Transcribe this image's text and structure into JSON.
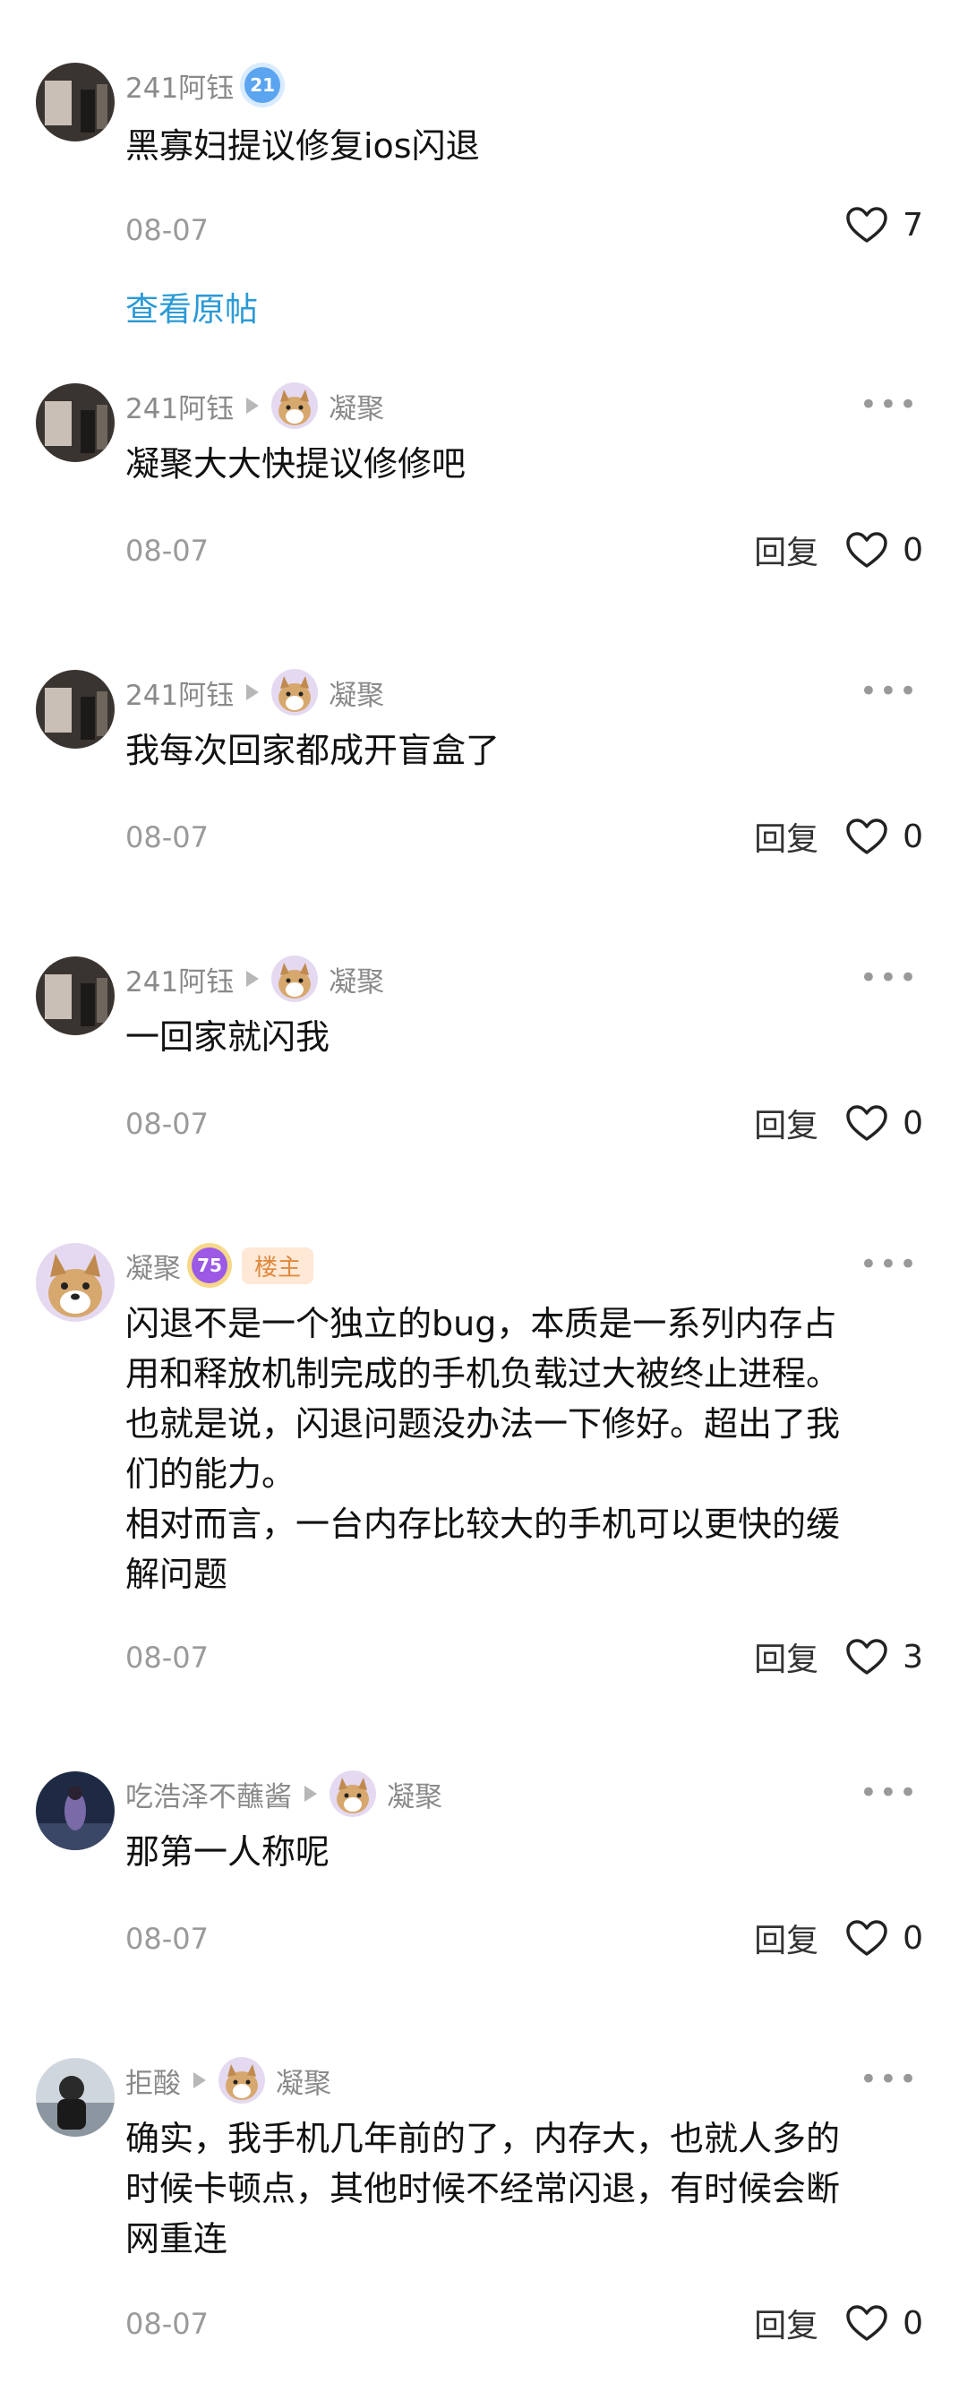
{
  "top_comment": {
    "user": "241阿钰",
    "level": "21",
    "text": "黑寡妇提议修复ios闪退",
    "date": "08-07",
    "likes": "7",
    "view_original": "查看原帖"
  },
  "replies": [
    {
      "user": "241阿钰",
      "target": "凝聚",
      "text": "凝聚大大快提议修修吧",
      "date": "08-07",
      "reply_label": "回复",
      "likes": "0"
    },
    {
      "user": "241阿钰",
      "target": "凝聚",
      "text": "我每次回家都成开盲盒了",
      "date": "08-07",
      "reply_label": "回复",
      "likes": "0"
    },
    {
      "user": "241阿钰",
      "target": "凝聚",
      "text": "一回家就闪我",
      "date": "08-07",
      "reply_label": "回复",
      "likes": "0"
    },
    {
      "user": "凝聚",
      "level": "75",
      "badge": "楼主",
      "text": "闪退不是一个独立的bug，本质是一系列内存占\n用和释放机制完成的手机负载过大被终止进程。\n也就是说，闪退问题没办法一下修好。超出了我\n们的能力。\n相对而言，一台内存比较大的手机可以更快的缓\n解问题",
      "date": "08-07",
      "reply_label": "回复",
      "likes": "3"
    },
    {
      "user": "吃浩泽不蘸酱",
      "target": "凝聚",
      "text": "那第一人称呢",
      "date": "08-07",
      "reply_label": "回复",
      "likes": "0"
    },
    {
      "user": "拒酸",
      "target": "凝聚",
      "text": "确实，我手机几年前的了，内存大，也就人多的\n时候卡顿点，其他时候不经常闪退，有时候会断\n网重连",
      "date": "08-07",
      "reply_label": "回复",
      "likes": "0"
    }
  ],
  "more_label": "•••",
  "avatar_art": "凝聚"
}
